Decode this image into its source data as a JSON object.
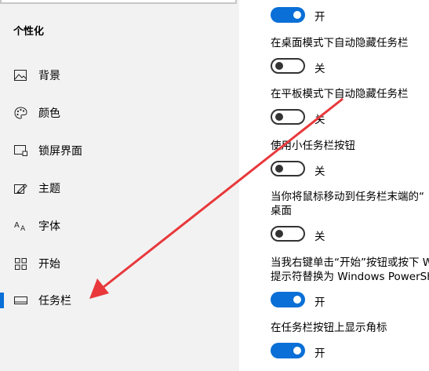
{
  "sidebar": {
    "title": "个性化",
    "items": [
      {
        "label": "背景",
        "icon": "picture-icon"
      },
      {
        "label": "颜色",
        "icon": "palette-icon"
      },
      {
        "label": "锁屏界面",
        "icon": "lock-screen-icon"
      },
      {
        "label": "主题",
        "icon": "theme-icon"
      },
      {
        "label": "字体",
        "icon": "font-icon"
      },
      {
        "label": "开始",
        "icon": "start-icon"
      },
      {
        "label": "任务栏",
        "icon": "taskbar-icon",
        "active": true
      }
    ]
  },
  "settings": [
    {
      "label": "",
      "state": "开",
      "on": true
    },
    {
      "label": "在桌面模式下自动隐藏任务栏",
      "state": "关",
      "on": false
    },
    {
      "label": "在平板模式下自动隐藏任务栏",
      "state": "关",
      "on": false
    },
    {
      "label": "使用小任务栏按钮",
      "state": "关",
      "on": false
    },
    {
      "label": "当你将鼠标移动到任务栏末端的“",
      "label2": "桌面",
      "state": "关",
      "on": false
    },
    {
      "label": "当我右键单击“开始”按钮或按下 W",
      "label2": "提示符替换为 Windows PowerSh",
      "state": "开",
      "on": true
    },
    {
      "label": "在任务栏按钮上显示角标",
      "state": "开",
      "on": true
    }
  ],
  "colors": {
    "accent": "#0a6fd6",
    "annotation_arrow": "#e8383b",
    "sidebar_bg": "#f2f2f2"
  }
}
